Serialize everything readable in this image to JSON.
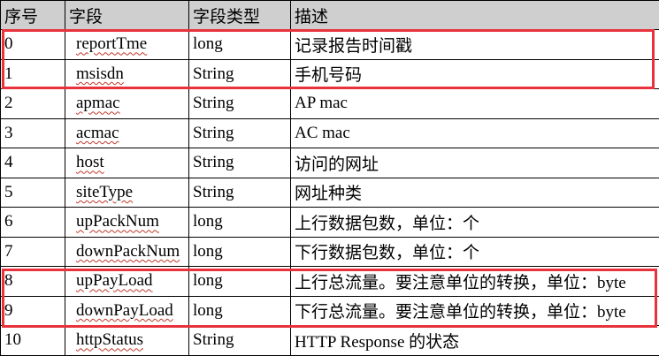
{
  "headers": [
    "序号",
    "字段",
    "字段类型",
    "描述"
  ],
  "rows": [
    {
      "index": "0",
      "field": "reportTme",
      "type": "long",
      "description": "记录报告时间戳"
    },
    {
      "index": "1",
      "field": "msisdn",
      "type": "String",
      "description": "手机号码"
    },
    {
      "index": "2",
      "field": "apmac",
      "type": "String",
      "description": "AP mac"
    },
    {
      "index": "3",
      "field": "acmac",
      "type": "String",
      "description": "AC mac"
    },
    {
      "index": "4",
      "field": "host",
      "type": "String",
      "description": "访问的网址"
    },
    {
      "index": "5",
      "field": "siteType",
      "type": "String",
      "description": "网址种类"
    },
    {
      "index": "6",
      "field": "upPackNum",
      "type": "long",
      "description": "上行数据包数，单位：个"
    },
    {
      "index": "7",
      "field": "downPackNum",
      "type": "long",
      "description": "下行数据包数，单位：个"
    },
    {
      "index": "8",
      "field": "upPayLoad",
      "type": "long",
      "description": "上行总流量。要注意单位的转换，单位：byte"
    },
    {
      "index": "9",
      "field": "downPayLoad",
      "type": "long",
      "description": "下行总流量。要注意单位的转换，单位：byte"
    },
    {
      "index": "10",
      "field": "httpStatus",
      "type": "String",
      "description": "HTTP Response 的状态"
    }
  ],
  "highlight_color": "#e8323c",
  "header_background": "#cfcfcf"
}
